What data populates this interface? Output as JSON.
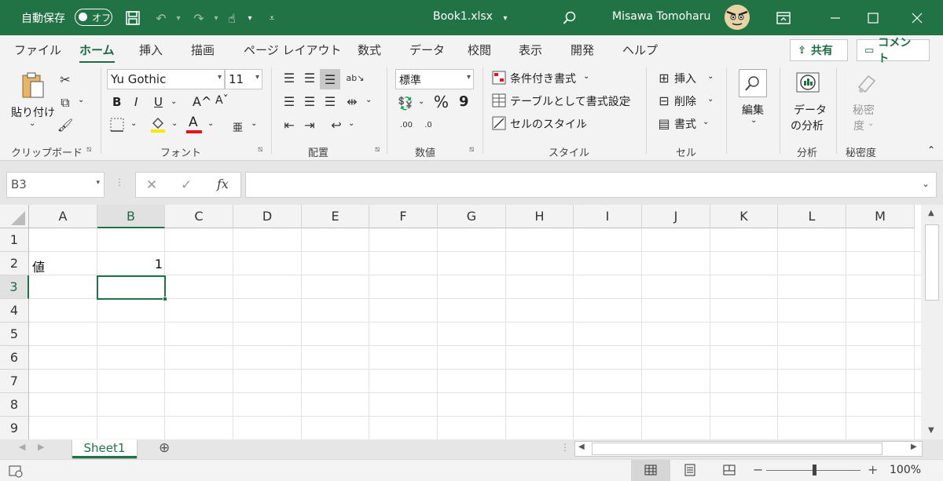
{
  "titlebar": {
    "autosave_label": "自動保存",
    "autosave_state": "オフ",
    "filename": "Book1.xlsx",
    "user_name": "Misawa Tomoharu"
  },
  "tabs": [
    "ファイル",
    "ホーム",
    "挿入",
    "描画",
    "ページ レイアウト",
    "数式",
    "データ",
    "校閲",
    "表示",
    "開発",
    "ヘルプ"
  ],
  "active_tab": "ホーム",
  "share_label": "共有",
  "comment_label": "コメント",
  "ribbon": {
    "clipboard": {
      "paste_label": "貼り付け",
      "group_label": "クリップボード"
    },
    "font": {
      "font_name": "Yu Gothic",
      "font_size": "11",
      "bold": "B",
      "italic": "I",
      "underline": "U",
      "grow": "A^",
      "shrink": "Aˇ",
      "color_letter": "A",
      "furigana": "亜",
      "group_label": "フォント"
    },
    "alignment": {
      "group_label": "配置"
    },
    "number": {
      "format": "標準",
      "percent": "%",
      "comma": "9",
      "group_label": "数値"
    },
    "styles": {
      "conditional": "条件付き書式",
      "table": "テーブルとして書式設定",
      "cell_styles": "セルのスタイル",
      "group_label": "スタイル"
    },
    "cells": {
      "insert": "挿入",
      "delete": "削除",
      "format": "書式",
      "group_label": "セル"
    },
    "editing": {
      "label": "編集"
    },
    "analysis": {
      "label_line1": "データ",
      "label_line2": "の分析",
      "group_label": "分析"
    },
    "sensitivity": {
      "label_line1": "秘密",
      "label_line2": "度",
      "group_label": "秘密度"
    }
  },
  "formula_bar": {
    "name_box": "B3",
    "fx": "fx",
    "formula": ""
  },
  "columns": [
    "A",
    "B",
    "C",
    "D",
    "E",
    "F",
    "G",
    "H",
    "I",
    "J",
    "K",
    "L",
    "M"
  ],
  "rows": [
    "1",
    "2",
    "3",
    "4",
    "5",
    "6",
    "7",
    "8",
    "9"
  ],
  "selected_cell": {
    "column": "B",
    "row": "3"
  },
  "cells": {
    "A2": "値",
    "B2": "1"
  },
  "sheets": [
    "Sheet1"
  ],
  "zoom": "100%",
  "colors": {
    "brand": "#217346",
    "active_tab": "#1e6c41"
  }
}
